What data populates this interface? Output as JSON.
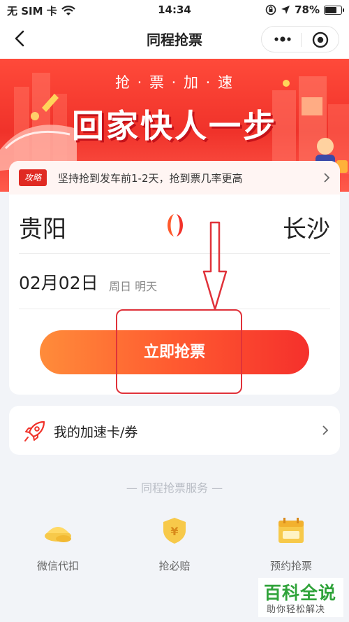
{
  "status_bar": {
    "carrier": "无 SIM 卡",
    "time": "14:34",
    "battery": "78%",
    "battery_level": 0.78
  },
  "nav": {
    "title": "同程抢票"
  },
  "banner": {
    "subtitle": "抢 · 票 · 加 · 速",
    "title": "回家快人一步"
  },
  "tip": {
    "badge": "攻略",
    "text": "坚持抢到发车前1-2天，抢到票几率更高"
  },
  "trip": {
    "from_city": "贵阳",
    "to_city": "长沙",
    "date": "02月02日",
    "date_hint": "周日 明天"
  },
  "grab_button_label": "立即抢票",
  "accel_card": {
    "label": "我的加速卡/券"
  },
  "services": {
    "title": "— 同程抢票服务 —",
    "items": [
      {
        "label": "微信代扣",
        "icon": "gold-ingot-icon"
      },
      {
        "label": "抢必赔",
        "icon": "yuan-shield-icon"
      },
      {
        "label": "预约抢票",
        "icon": "calendar-icon"
      }
    ]
  },
  "watermark": {
    "title": "百科全说",
    "subtitle": "助你轻松解决"
  },
  "colors": {
    "accent_red": "#f0322a",
    "button_start": "#ff8c3a",
    "button_end": "#f5302c",
    "annotation_red": "#e0323a"
  }
}
